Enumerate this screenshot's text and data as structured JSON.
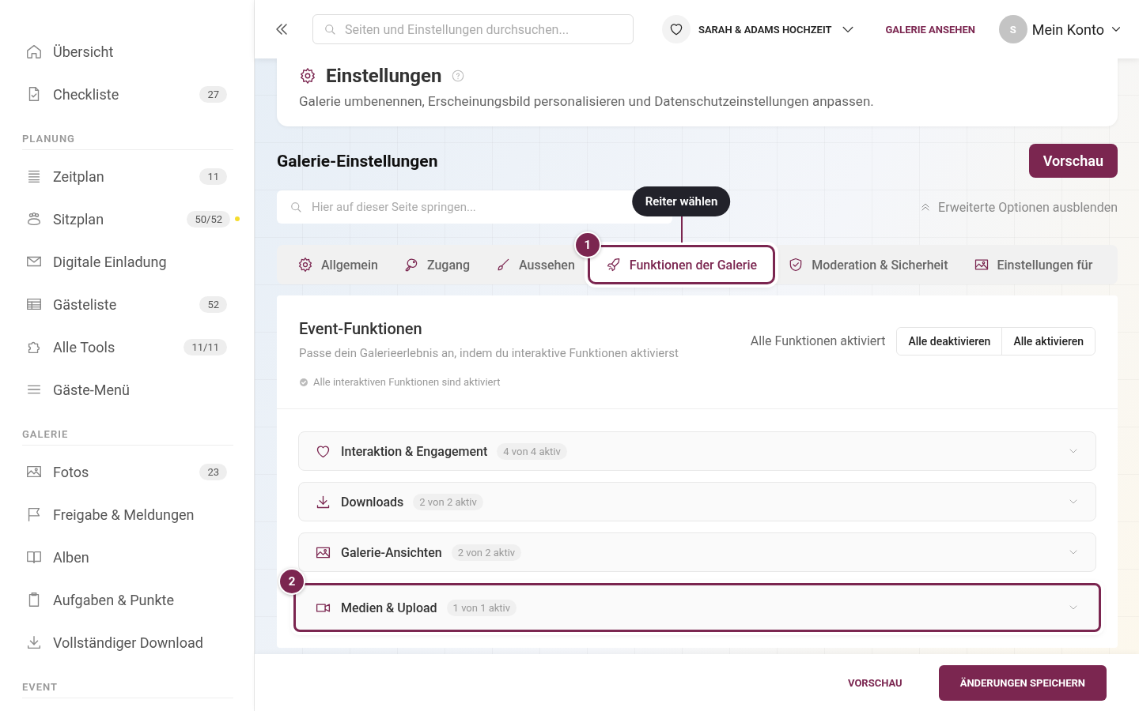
{
  "sidebar": {
    "sections": [
      {
        "items": [
          {
            "label": "Übersicht"
          },
          {
            "label": "Checkliste",
            "badge": "27"
          }
        ]
      },
      {
        "heading": "PLANUNG",
        "items": [
          {
            "label": "Zeitplan",
            "badge": "11"
          },
          {
            "label": "Sitzplan",
            "badge": "50/52",
            "color": "#f5dc2e"
          },
          {
            "label": "Digitale Einladung"
          },
          {
            "label": "Gästeliste",
            "badge": "52"
          },
          {
            "label": "Alle Tools",
            "badge": "11/11"
          },
          {
            "label": "Gäste-Menü"
          }
        ]
      },
      {
        "heading": "GALERIE",
        "items": [
          {
            "label": "Fotos",
            "badge": "23"
          },
          {
            "label": "Freigabe & Meldungen"
          },
          {
            "label": "Alben"
          },
          {
            "label": "Aufgaben & Punkte"
          },
          {
            "label": "Vollständiger Download"
          }
        ]
      },
      {
        "heading": "EVENT"
      }
    ]
  },
  "header": {
    "search": {
      "placeholder": "Seiten und Einstellungen durchsuchen..."
    },
    "event": "SARAH & ADAMS HOCHZEIT",
    "view_link": "GALERIE ANSEHEN",
    "avatar": "S",
    "account": "Mein Konto"
  },
  "page": {
    "title": "Einstellungen",
    "description": "Galerie umbenennen, Erscheinungsbild personalisieren und Datenschutzeinstellungen anpassen."
  },
  "section": {
    "title": "Galerie-Einstellungen",
    "preview_button": "Vorschau",
    "search": {
      "placeholder": "Hier auf dieser Seite springen..."
    },
    "advanced_toggle": "Erweiterte Optionen ausblenden"
  },
  "tooltip": "Reiter wählen",
  "tabs": [
    {
      "label": "Allgemein",
      "selected": false
    },
    {
      "label": "Zugang",
      "selected": false
    },
    {
      "label": "Aussehen",
      "selected": false
    },
    {
      "label": "Funktionen der Galerie",
      "selected": true,
      "marker": "1"
    },
    {
      "label": "Moderation & Sicherheit",
      "selected": false
    },
    {
      "label": "Einstellungen für",
      "selected": false
    }
  ],
  "features": {
    "title": "Event-Funktionen",
    "description": "Passe dein Galerieerlebnis an, indem du interaktive Funktionen aktivierst",
    "status": "Alle Funktionen aktiviert",
    "buttons": [
      "Alle deaktivieren",
      "Alle aktivieren"
    ],
    "note": "Alle interaktiven Funktionen sind aktiviert",
    "groups": [
      {
        "title": "Interaktion & Engagement",
        "count": "4 von 4 aktiv",
        "expanded": false,
        "highlighted": false
      },
      {
        "title": "Downloads",
        "count": "2 von 2 aktiv",
        "expanded": false,
        "highlighted": false
      },
      {
        "title": "Galerie-Ansichten",
        "count": "2 von 2 aktiv",
        "expanded": false,
        "highlighted": false
      },
      {
        "title": "Medien & Upload",
        "count": "1 von 1 aktiv",
        "expanded": false,
        "highlighted": true,
        "marker": "2"
      }
    ]
  },
  "footer": {
    "preview": "VORSCHAU",
    "save": "ÄNDERUNGEN SPEICHERN"
  }
}
